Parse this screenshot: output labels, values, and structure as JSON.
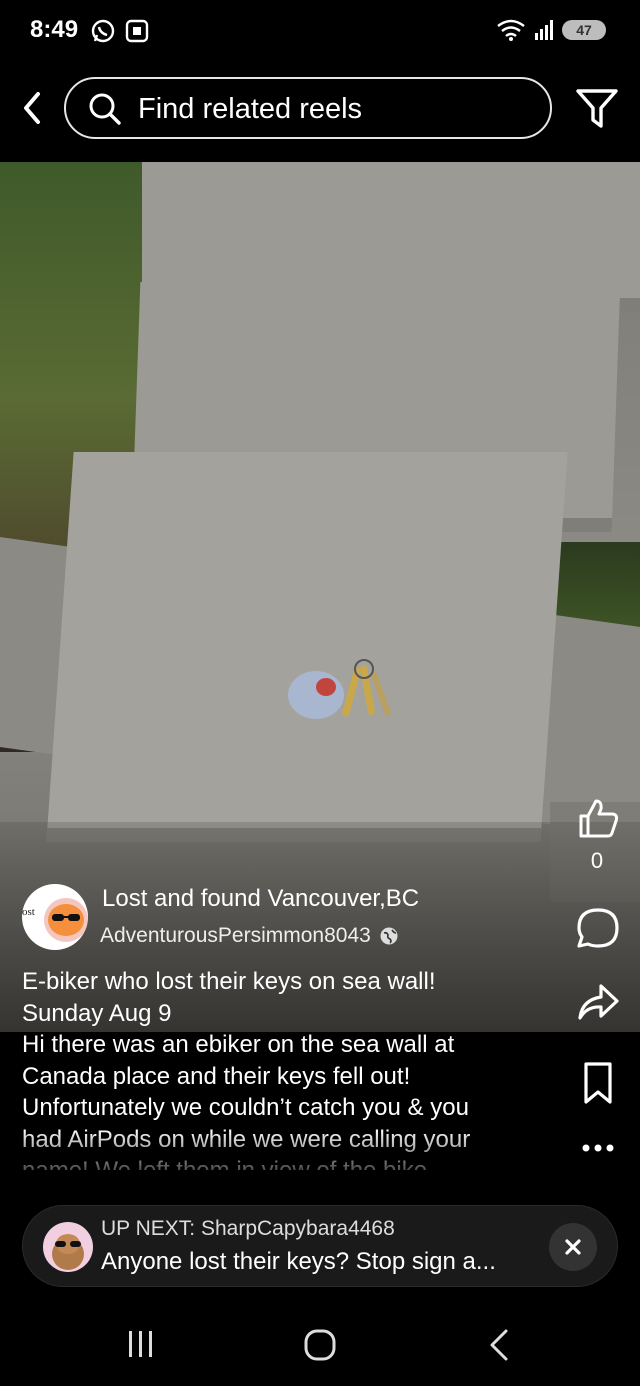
{
  "status_bar": {
    "time": "8:49",
    "battery": "47"
  },
  "search": {
    "placeholder": "Find related reels"
  },
  "post": {
    "group_name": "Lost and found Vancouver,BC",
    "username": "AdventurousPersimmon8043",
    "avatar_text": "ost",
    "like_count": "0",
    "caption_lines": [
      "E-biker who lost their keys on sea wall!",
      "Sunday Aug 9",
      "Hi there was an ebiker on the sea wall at",
      "Canada place and their keys fell out!",
      "Unfortunately we couldn’t catch you & you",
      "had AirPods on while we were calling your",
      "name! We left them in view of the bike"
    ]
  },
  "up_next": {
    "label": "UP NEXT: SharpCapybara4468",
    "title": "Anyone lost their keys? Stop sign a..."
  },
  "icons": {
    "status": [
      "whatsapp-icon",
      "screenshot-icon",
      "wifi-icon",
      "signal-icon",
      "battery-icon"
    ],
    "top": [
      "back-arrow-icon",
      "search-icon",
      "filter-icon"
    ],
    "actions": [
      "like-icon",
      "comment-icon",
      "share-icon",
      "bookmark-icon",
      "more-icon"
    ],
    "nav": [
      "recents-icon",
      "home-icon",
      "back-icon"
    ]
  }
}
